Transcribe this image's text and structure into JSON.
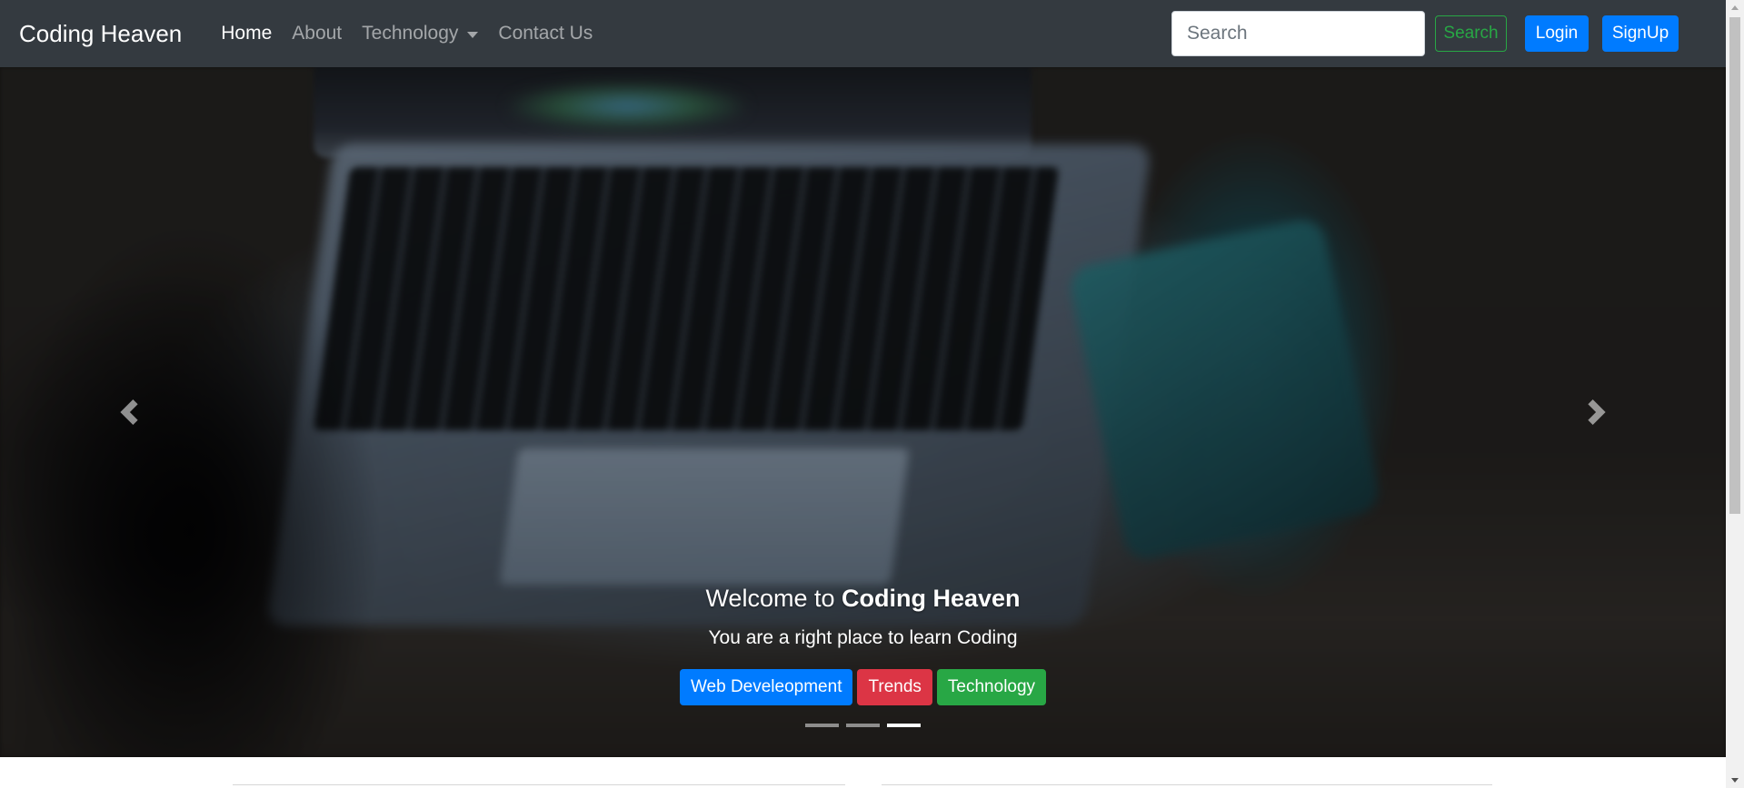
{
  "navbar": {
    "brand": "Coding Heaven",
    "links": [
      {
        "label": "Home",
        "active": true
      },
      {
        "label": "About",
        "active": false
      },
      {
        "label": "Technology",
        "active": false,
        "dropdown": true
      },
      {
        "label": "Contact Us",
        "active": false
      }
    ],
    "search_placeholder": "Search",
    "search_button": "Search",
    "login_button": "Login",
    "signup_button": "SignUp"
  },
  "carousel": {
    "caption_title_prefix": "Welcome to",
    "caption_title_bold": "Coding Heaven",
    "caption_text": "You are a right place to learn Coding",
    "buttons": [
      {
        "label": "Web Develeopment",
        "color": "#007bff"
      },
      {
        "label": "Trends",
        "color": "#dc3545"
      },
      {
        "label": "Technology",
        "color": "#28a745"
      }
    ],
    "indicators": 3,
    "active_indicator": 3,
    "prev_icon": "chevron-left-icon",
    "next_icon": "chevron-right-icon"
  },
  "colors": {
    "navbar_bg": "#343a40",
    "primary": "#007bff",
    "success": "#28a745",
    "danger": "#dc3545"
  }
}
